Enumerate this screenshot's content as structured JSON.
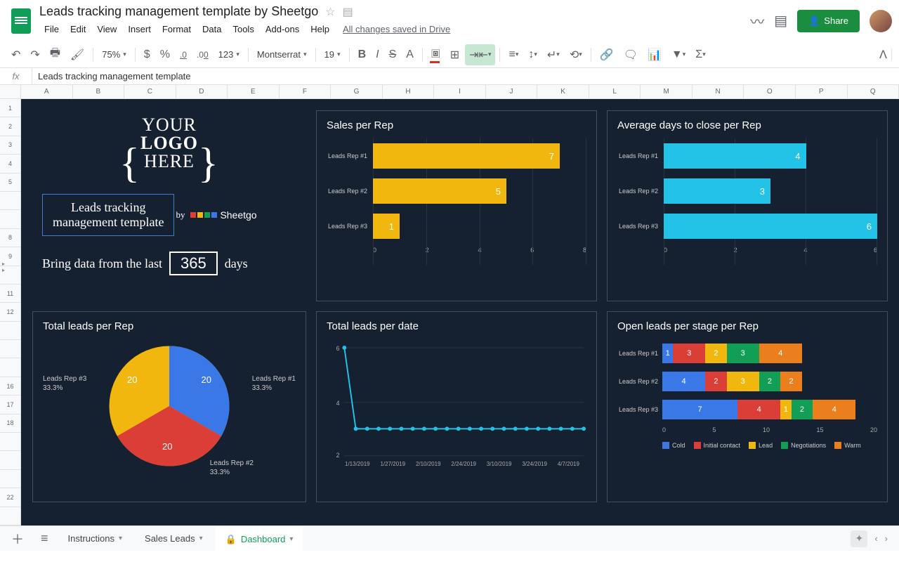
{
  "doc": {
    "title": "Leads tracking management template by Sheetgo",
    "changes": "All changes saved in Drive"
  },
  "menus": [
    "File",
    "Edit",
    "View",
    "Insert",
    "Format",
    "Data",
    "Tools",
    "Add-ons",
    "Help"
  ],
  "share": "Share",
  "toolbar": {
    "zoom": "75%",
    "font": "Montserrat",
    "size": "19",
    "curr": "$",
    "pct": "%",
    "dec_dec": ".0",
    "dec_inc": ".00",
    "more": "123"
  },
  "fx": {
    "content": "Leads tracking management template"
  },
  "columns": [
    "A",
    "B",
    "C",
    "D",
    "E",
    "F",
    "G",
    "H",
    "I",
    "J",
    "K",
    "L",
    "M",
    "N",
    "O",
    "P",
    "Q"
  ],
  "rows": [
    "1",
    "2",
    "3",
    "4",
    "5",
    "",
    "",
    "8",
    "9",
    "",
    "11",
    "12",
    "",
    "",
    "",
    "16",
    "17",
    "18",
    "",
    "",
    "",
    "22",
    ""
  ],
  "logo_text": {
    "l1": "YOUR",
    "l2": "LOGO",
    "l3": "HERE"
  },
  "template_box": {
    "l1": "Leads tracking",
    "l2": "management template"
  },
  "by": "by",
  "brand": "Sheetgo",
  "bring": {
    "pre": "Bring data from the last",
    "days": "365",
    "post": "days"
  },
  "chart_data": [
    {
      "id": "sales_per_rep",
      "type": "bar",
      "title": "Sales per Rep",
      "orientation": "horizontal",
      "categories": [
        "Leads Rep #1",
        "Leads Rep #2",
        "Leads Rep #3"
      ],
      "values": [
        7,
        5,
        1
      ],
      "xlim": [
        0,
        8
      ],
      "xticks": [
        0,
        2,
        4,
        6,
        8
      ],
      "color": "#f1b70e"
    },
    {
      "id": "avg_days_close",
      "type": "bar",
      "title": "Average days to close per Rep",
      "orientation": "horizontal",
      "categories": [
        "Leads Rep #1",
        "Leads Rep #2",
        "Leads Rep #3"
      ],
      "values": [
        4,
        3,
        6
      ],
      "xlim": [
        0,
        6
      ],
      "xticks": [
        0,
        2,
        4,
        6
      ],
      "color": "#23c3e8"
    },
    {
      "id": "total_leads_per_rep",
      "type": "pie",
      "title": "Total leads per Rep",
      "categories": [
        "Leads Rep #1",
        "Leads Rep #2",
        "Leads Rep #3"
      ],
      "values": [
        20,
        20,
        20
      ],
      "percents": [
        "33.3%",
        "33.3%",
        "33.3%"
      ],
      "colors": [
        "#3b78e7",
        "#db3e36",
        "#f1b70e"
      ]
    },
    {
      "id": "total_leads_per_date",
      "type": "line",
      "title": "Total leads per date",
      "ylim": [
        2,
        6
      ],
      "yticks": [
        2,
        4,
        6
      ],
      "xlabels": [
        "1/13/2019",
        "1/27/2019",
        "2/10/2019",
        "2/24/2019",
        "3/10/2019",
        "3/24/2019",
        "4/7/2019"
      ],
      "series": [
        {
          "name": "leads",
          "color": "#23c3e8",
          "values": [
            6,
            3,
            3,
            3,
            3,
            3,
            3,
            3,
            3,
            3,
            3,
            3,
            3,
            3,
            3,
            3,
            3,
            3,
            3,
            3,
            3,
            3
          ]
        }
      ]
    },
    {
      "id": "open_leads_stage",
      "type": "bar",
      "subtype": "stacked",
      "title": "Open leads per stage per Rep",
      "orientation": "horizontal",
      "categories": [
        "Leads Rep #1",
        "Leads Rep #2",
        "Leads Rep #3"
      ],
      "series": [
        {
          "name": "Cold",
          "color": "#3b78e7",
          "values": [
            1,
            4,
            7
          ]
        },
        {
          "name": "Initial contact",
          "color": "#db3e36",
          "values": [
            3,
            2,
            4
          ]
        },
        {
          "name": "Lead",
          "color": "#f1b70e",
          "values": [
            2,
            3,
            1
          ]
        },
        {
          "name": "Negotiations",
          "color": "#119f55",
          "values": [
            3,
            2,
            2
          ]
        },
        {
          "name": "Warm",
          "color": "#ec7f1d",
          "values": [
            4,
            2,
            4
          ]
        }
      ],
      "xlim": [
        0,
        20
      ],
      "xticks": [
        0,
        5,
        10,
        15,
        20
      ]
    }
  ],
  "tabs": {
    "instructions": "Instructions",
    "sales": "Sales Leads",
    "dashboard": "Dashboard"
  }
}
